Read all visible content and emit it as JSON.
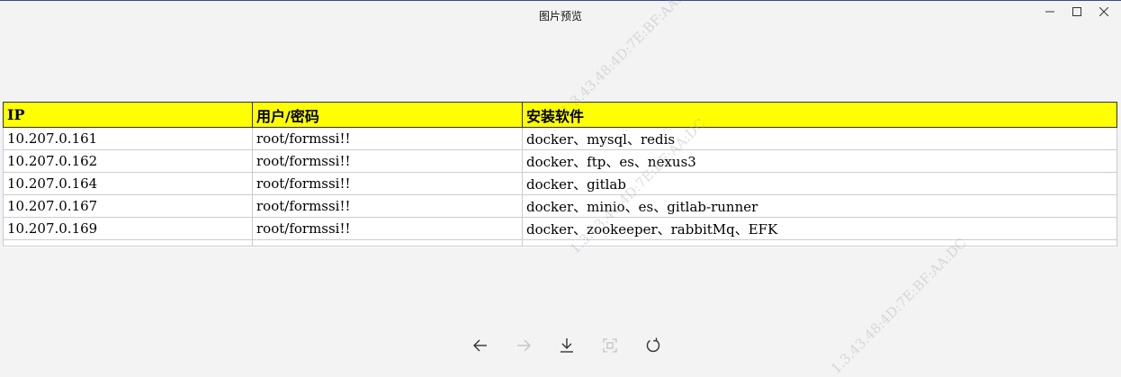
{
  "window": {
    "title": "图片预览"
  },
  "table": {
    "headers": [
      "IP",
      "用户/密码",
      "安装软件"
    ],
    "rows": [
      [
        "10.207.0.161",
        "root/formssi!!",
        "docker、mysql、redis"
      ],
      [
        "10.207.0.162",
        "root/formssi!!",
        "docker、ftp、es、nexus3"
      ],
      [
        "10.207.0.164",
        "root/formssi!!",
        "docker、gitlab"
      ],
      [
        "10.207.0.167",
        "root/formssi!!",
        "docker、minio、es、gitlab-runner"
      ],
      [
        "10.207.0.169",
        "root/formssi!!",
        "docker、zookeeper、rabbitMq、EFK"
      ]
    ],
    "header_color": "#ffff00"
  },
  "watermarks": [
    "1.3.43.48:4D:7E:BF:AA:DC",
    "1.3.43.48:4D:7E:BF:AA:DC",
    "1.3.43.48:4D:7E:BF:AA:DC"
  ],
  "toolbar": {
    "icons": [
      "arrow-left-icon",
      "arrow-right-icon",
      "download-icon",
      "fit-screen-icon",
      "rotate-icon"
    ]
  }
}
